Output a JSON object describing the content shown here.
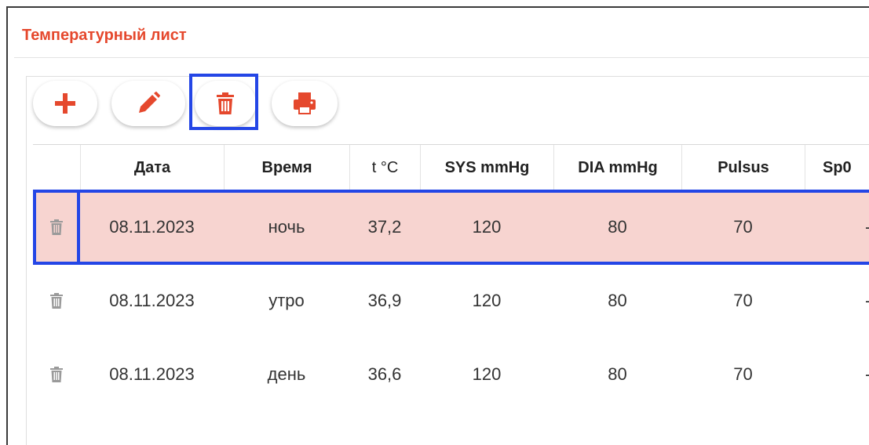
{
  "panel": {
    "title": "Температурный лист"
  },
  "toolbar": {
    "add_icon": "plus-icon",
    "edit_icon": "pencil-icon",
    "delete_icon": "trash-icon",
    "print_icon": "printer-icon"
  },
  "colors": {
    "accent": "#e5482d",
    "highlight": "#2446e6",
    "selected_row": "#f7d4d0"
  },
  "table": {
    "columns": [
      "Дата",
      "Время",
      "t °C",
      "SYS mmHg",
      "DIA mmHg",
      "Pulsus",
      "Sp0"
    ],
    "rows": [
      {
        "date": "08.11.2023",
        "time": "ночь",
        "temp": "37,2",
        "sys": "120",
        "dia": "80",
        "pulse": "70",
        "spo2": "-"
      },
      {
        "date": "08.11.2023",
        "time": "утро",
        "temp": "36,9",
        "sys": "120",
        "dia": "80",
        "pulse": "70",
        "spo2": "-"
      },
      {
        "date": "08.11.2023",
        "time": "день",
        "temp": "36,6",
        "sys": "120",
        "dia": "80",
        "pulse": "70",
        "spo2": "-"
      }
    ]
  }
}
